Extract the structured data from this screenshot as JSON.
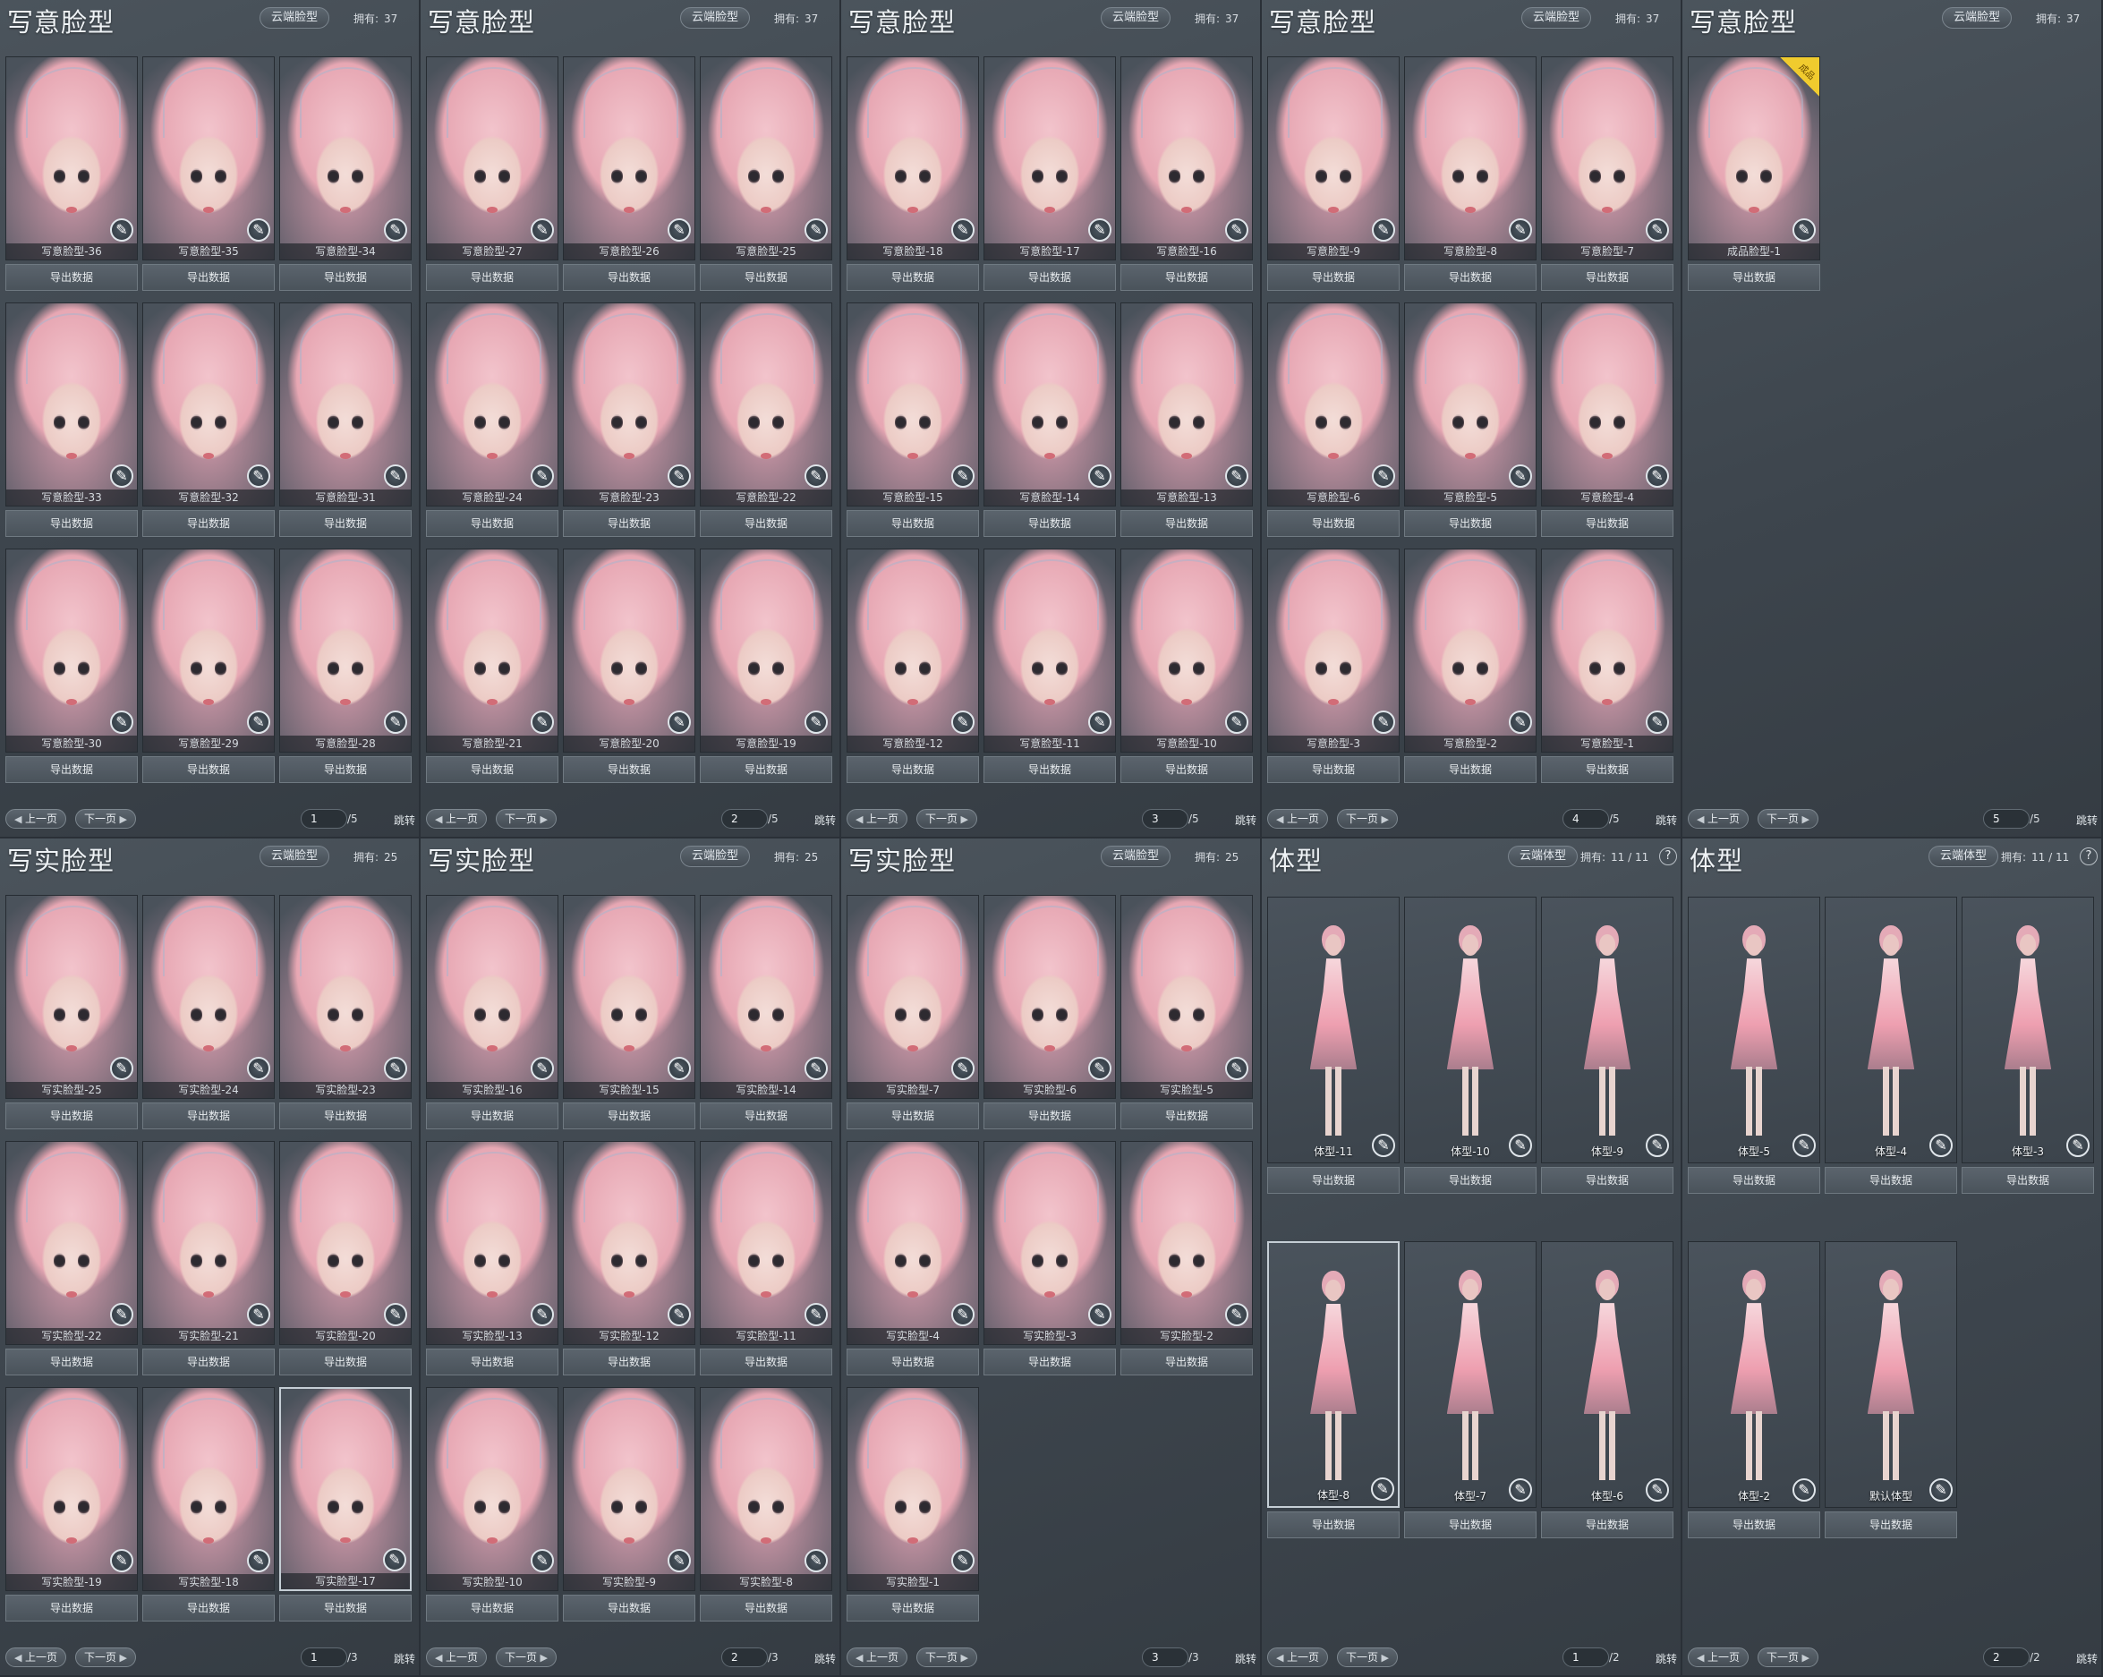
{
  "common": {
    "export_label": "导出数据",
    "prev_label": "上一页",
    "next_label": "下一页",
    "jump_label": "跳转",
    "edit_icon": "brush-icon",
    "help_text": "?"
  },
  "panels": [
    {
      "kind": "face",
      "title": "写意脸型",
      "cloud": "云端脸型",
      "owned_label": "拥有:",
      "owned_value": "37",
      "page": "1",
      "total": "/5",
      "items": [
        "写意脸型-36",
        "写意脸型-35",
        "写意脸型-34",
        "写意脸型-33",
        "写意脸型-32",
        "写意脸型-31",
        "写意脸型-30",
        "写意脸型-29",
        "写意脸型-28"
      ]
    },
    {
      "kind": "face",
      "title": "写意脸型",
      "cloud": "云端脸型",
      "owned_label": "拥有:",
      "owned_value": "37",
      "page": "2",
      "total": "/5",
      "items": [
        "写意脸型-27",
        "写意脸型-26",
        "写意脸型-25",
        "写意脸型-24",
        "写意脸型-23",
        "写意脸型-22",
        "写意脸型-21",
        "写意脸型-20",
        "写意脸型-19"
      ]
    },
    {
      "kind": "face",
      "title": "写意脸型",
      "cloud": "云端脸型",
      "owned_label": "拥有:",
      "owned_value": "37",
      "page": "3",
      "total": "/5",
      "items": [
        "写意脸型-18",
        "写意脸型-17",
        "写意脸型-16",
        "写意脸型-15",
        "写意脸型-14",
        "写意脸型-13",
        "写意脸型-12",
        "写意脸型-11",
        "写意脸型-10"
      ]
    },
    {
      "kind": "face",
      "title": "写意脸型",
      "cloud": "云端脸型",
      "owned_label": "拥有:",
      "owned_value": "37",
      "page": "4",
      "total": "/5",
      "items": [
        "写意脸型-9",
        "写意脸型-8",
        "写意脸型-7",
        "写意脸型-6",
        "写意脸型-5",
        "写意脸型-4",
        "写意脸型-3",
        "写意脸型-2",
        "写意脸型-1"
      ]
    },
    {
      "kind": "face",
      "title": "写意脸型",
      "cloud": "云端脸型",
      "owned_label": "拥有:",
      "owned_value": "37",
      "page": "5",
      "total": "/5",
      "items": [
        "成品脸型-1"
      ],
      "corner_badge": "成品"
    },
    {
      "kind": "face",
      "title": "写实脸型",
      "cloud": "云端脸型",
      "owned_label": "拥有:",
      "owned_value": "25",
      "page": "1",
      "total": "/3",
      "items": [
        "写实脸型-25",
        "写实脸型-24",
        "写实脸型-23",
        "写实脸型-22",
        "写实脸型-21",
        "写实脸型-20",
        "写实脸型-19",
        "写实脸型-18",
        "写实脸型-17"
      ],
      "selected_index": 8
    },
    {
      "kind": "face",
      "title": "写实脸型",
      "cloud": "云端脸型",
      "owned_label": "拥有:",
      "owned_value": "25",
      "page": "2",
      "total": "/3",
      "items": [
        "写实脸型-16",
        "写实脸型-15",
        "写实脸型-14",
        "写实脸型-13",
        "写实脸型-12",
        "写实脸型-11",
        "写实脸型-10",
        "写实脸型-9",
        "写实脸型-8"
      ]
    },
    {
      "kind": "face",
      "title": "写实脸型",
      "cloud": "云端脸型",
      "owned_label": "拥有:",
      "owned_value": "25",
      "page": "3",
      "total": "/3",
      "items": [
        "写实脸型-7",
        "写实脸型-6",
        "写实脸型-5",
        "写实脸型-4",
        "写实脸型-3",
        "写实脸型-2",
        "写实脸型-1"
      ]
    },
    {
      "kind": "body",
      "title": "体型",
      "cloud": "云端体型",
      "owned_label": "拥有:",
      "owned_value": "11 / 11",
      "page": "1",
      "total": "/2",
      "items": [
        "体型-11",
        "体型-10",
        "体型-9",
        "体型-8",
        "体型-7",
        "体型-6"
      ],
      "selected_index": 3
    },
    {
      "kind": "body",
      "title": "体型",
      "cloud": "云端体型",
      "owned_label": "拥有:",
      "owned_value": "11 / 11",
      "page": "2",
      "total": "/2",
      "items": [
        "体型-5",
        "体型-4",
        "体型-3",
        "体型-2",
        "默认体型"
      ]
    }
  ]
}
